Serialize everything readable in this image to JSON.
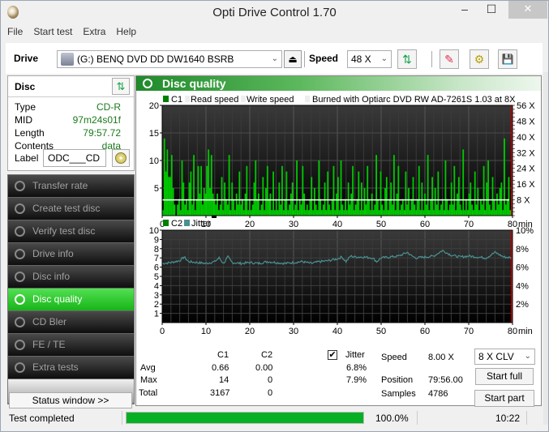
{
  "window": {
    "title": "Opti Drive Control 1.70",
    "min": "‒",
    "max": "☐",
    "close": "✕"
  },
  "menu": [
    "File",
    "Start test",
    "Extra",
    "Help"
  ],
  "toolbar": {
    "drive_label": "Drive",
    "drive_value": "(G:)  BENQ DVD DD DW1640 BSRB",
    "speed_label": "Speed",
    "speed_value": "48 X",
    "eject": "⏏",
    "refresh": "⇅",
    "erase": "✎",
    "settings": "⚙",
    "save": "💾"
  },
  "disc": {
    "title": "Disc",
    "refresh": "⇅",
    "rows": [
      {
        "k": "Type",
        "v": "CD-R"
      },
      {
        "k": "MID",
        "v": "97m24s01f"
      },
      {
        "k": "Length",
        "v": "79:57.72"
      },
      {
        "k": "Contents",
        "v": "data"
      }
    ],
    "label_key": "Label",
    "label_value": "ODC___CD"
  },
  "nav": [
    {
      "label": "Transfer rate",
      "active": false
    },
    {
      "label": "Create test disc",
      "active": false
    },
    {
      "label": "Verify test disc",
      "active": false
    },
    {
      "label": "Drive info",
      "active": false
    },
    {
      "label": "Disc info",
      "active": false
    },
    {
      "label": "Disc quality",
      "active": true
    },
    {
      "label": "CD Bler",
      "active": false
    },
    {
      "label": "FE / TE",
      "active": false
    },
    {
      "label": "Extra tests",
      "active": false
    }
  ],
  "status_button": "Status window >>",
  "panel_title": "Disc quality",
  "chart_data": [
    {
      "type": "bar",
      "title": "C1",
      "legend": [
        "C1",
        "Read speed",
        "Write speed",
        "Burned with Optiarc DVD RW AD-7261S 1.03 at 8X"
      ],
      "legend_colors": {
        "C1": "#008000",
        "Read speed": "#ffffff",
        "Write speed": "#e0e0e0"
      },
      "xlabel": "min",
      "x_ticks": [
        0,
        10,
        20,
        30,
        40,
        50,
        60,
        70,
        80
      ],
      "xlim": [
        0,
        80
      ],
      "y_ticks": [
        5,
        10,
        15,
        20
      ],
      "ylim": [
        0,
        20
      ],
      "y2_ticks": [
        "8 X",
        "16 X",
        "24 X",
        "32 X",
        "40 X",
        "48 X",
        "56 X"
      ],
      "y2lim": [
        0,
        56
      ],
      "read_speed_x": 8,
      "series": [
        {
          "name": "C1",
          "color": "#00c800",
          "values": [
            1,
            14,
            8,
            12,
            7,
            7,
            11,
            5,
            2,
            0,
            2,
            3,
            1,
            10,
            6,
            2,
            3,
            1,
            6,
            8,
            2,
            11,
            1,
            3,
            9,
            4,
            9,
            2,
            5,
            4,
            9,
            12,
            5,
            11,
            4,
            3,
            2,
            4,
            1,
            2,
            7,
            1,
            6,
            3,
            2,
            11,
            1,
            6,
            3,
            1,
            4,
            2,
            8,
            2,
            3,
            1,
            4,
            9,
            1,
            3,
            1,
            2,
            6,
            10,
            3,
            4,
            1,
            2,
            7,
            1,
            5,
            9,
            3,
            4,
            1,
            8,
            1,
            3,
            1,
            6,
            2,
            9,
            1,
            3,
            8,
            1,
            2,
            4,
            6,
            1,
            2,
            10,
            1,
            3,
            2,
            9,
            4,
            1,
            2,
            1,
            3,
            7,
            1,
            5,
            2,
            1,
            10,
            3,
            1,
            2,
            6,
            1,
            8,
            2,
            1,
            3,
            9,
            1,
            4,
            7,
            1,
            10,
            2,
            1,
            3,
            1,
            6,
            2,
            4,
            9,
            1,
            2,
            3,
            8,
            1,
            6,
            1,
            5,
            2,
            9,
            3,
            1,
            4,
            1,
            2,
            11,
            3,
            1,
            8,
            2,
            1,
            5,
            7,
            1,
            3,
            6,
            2,
            11,
            1,
            4,
            9,
            1,
            2,
            3,
            1,
            8,
            2,
            5,
            1,
            3,
            7,
            2,
            1,
            3,
            9,
            1,
            6,
            1,
            4,
            2,
            11,
            1,
            3,
            7,
            1,
            5,
            2,
            8,
            1,
            2,
            3,
            1,
            10,
            3,
            1,
            2,
            6,
            2,
            9,
            1,
            4,
            7,
            2,
            1,
            12,
            1,
            3,
            1,
            4,
            6,
            2,
            1,
            8,
            2,
            5,
            1,
            3,
            2,
            9,
            1,
            6,
            10,
            2,
            1,
            7,
            3,
            1,
            4,
            2,
            5,
            6,
            1,
            14,
            2,
            3,
            7,
            1,
            4
          ]
        }
      ]
    },
    {
      "type": "line",
      "title": "C2 / Jitter",
      "legend": [
        "C2",
        "Jitter"
      ],
      "legend_colors": {
        "C2": "#008000",
        "Jitter": "#4a9090"
      },
      "xlabel": "min",
      "x_ticks": [
        0,
        10,
        20,
        30,
        40,
        50,
        60,
        70,
        80
      ],
      "xlim": [
        0,
        80
      ],
      "y_ticks": [
        1,
        2,
        3,
        4,
        5,
        6,
        7,
        8,
        9,
        10
      ],
      "ylim": [
        0,
        10
      ],
      "y2_ticks": [
        "2%",
        "4%",
        "6%",
        "8%",
        "10%"
      ],
      "y2lim": [
        0,
        10
      ],
      "series": [
        {
          "name": "C2",
          "color": "#008000",
          "values": [
            0
          ]
        },
        {
          "name": "Jitter",
          "color": "#4a9090",
          "x": [
            0,
            2,
            4,
            5,
            6,
            8,
            10,
            12,
            13,
            14,
            15,
            16,
            18,
            20,
            22,
            24,
            26,
            28,
            30,
            32,
            34,
            36,
            38,
            40,
            41,
            42,
            43,
            44,
            46,
            48,
            49,
            50,
            52,
            54,
            56,
            57,
            58,
            60,
            62,
            64,
            66,
            68,
            70,
            72,
            74,
            76,
            78,
            80
          ],
          "values": [
            6.4,
            6.5,
            6.7,
            7.1,
            6.6,
            6.5,
            6.4,
            6.6,
            7.0,
            6.4,
            7.1,
            6.5,
            6.4,
            6.5,
            6.4,
            6.6,
            6.5,
            6.4,
            6.5,
            6.6,
            6.4,
            6.6,
            6.7,
            6.9,
            7.1,
            6.6,
            7.2,
            7.1,
            7.1,
            7.0,
            6.6,
            7.0,
            7.1,
            7.2,
            7.6,
            7.2,
            7.0,
            7.1,
            7.2,
            7.8,
            7.3,
            7.1,
            7.2,
            7.1,
            7.0,
            7.6,
            7.1,
            7.0
          ]
        }
      ]
    }
  ],
  "stats": {
    "col_c1": "C1",
    "col_c2": "C2",
    "jitter_label": "Jitter",
    "jitter_checked": true,
    "rows": [
      {
        "label": "Avg",
        "c1": "0.66",
        "c2": "0.00",
        "jitter": "6.8%"
      },
      {
        "label": "Max",
        "c1": "14",
        "c2": "0",
        "jitter": "7.9%"
      },
      {
        "label": "Total",
        "c1": "3167",
        "c2": "0",
        "jitter": ""
      }
    ],
    "speed_label": "Speed",
    "speed_value": "8.00 X",
    "position_label": "Position",
    "position_value": "79:56.00",
    "samples_label": "Samples",
    "samples_value": "4786",
    "mode_value": "8 X CLV",
    "start_full": "Start full",
    "start_part": "Start part"
  },
  "statusbar": {
    "text": "Test completed",
    "progress": 1.0,
    "progress_text": "100.0%",
    "time": "10:22"
  }
}
